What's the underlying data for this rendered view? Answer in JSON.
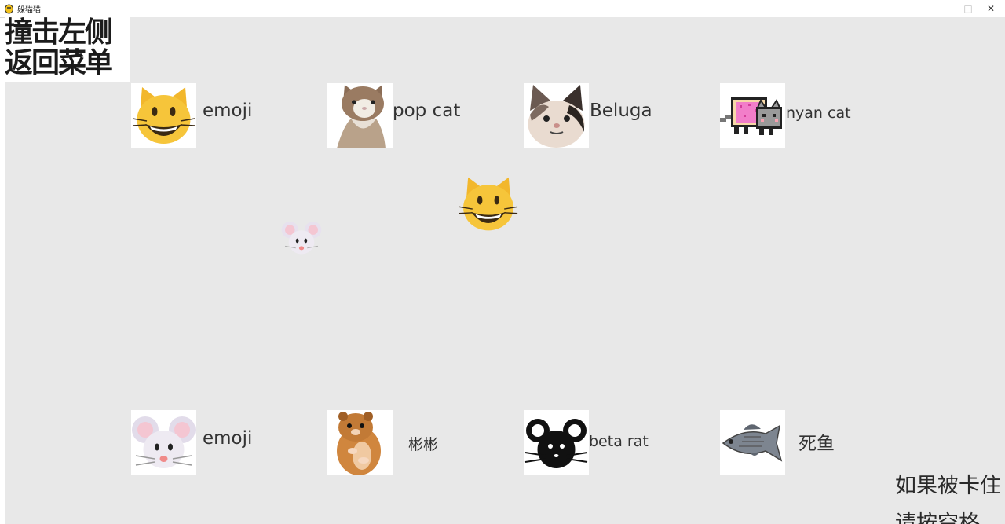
{
  "window": {
    "title": "躲猫猫",
    "minimize_glyph": "—",
    "maximize_glyph": "□",
    "close_glyph": "✕"
  },
  "back": {
    "line1": "撞击左侧",
    "line2": "返回菜单"
  },
  "cats": [
    {
      "label": "emoji",
      "icon": "cat-emoji-icon"
    },
    {
      "label": "pop cat",
      "icon": "pop-cat-icon"
    },
    {
      "label": "Beluga",
      "icon": "beluga-cat-icon"
    },
    {
      "label": "nyan cat",
      "icon": "nyan-cat-icon"
    }
  ],
  "rats": [
    {
      "label": "emoji",
      "icon": "mouse-emoji-icon"
    },
    {
      "label": "彬彬",
      "icon": "hamster-icon"
    },
    {
      "label": "beta rat",
      "icon": "beta-rat-icon"
    },
    {
      "label": "死鱼",
      "icon": "dead-fish-icon"
    }
  ],
  "hint": {
    "line1": "如果被卡住",
    "line2": "请按空格"
  },
  "colors": {
    "canvas": "#e8e8e8",
    "cat_yellow": "#f6c53a",
    "nyan_pink": "#f27ec9"
  }
}
